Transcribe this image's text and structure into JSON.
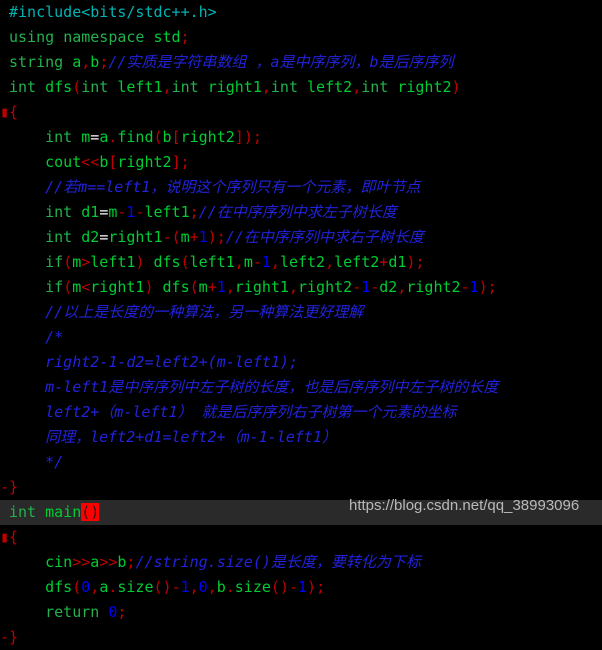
{
  "editor": {
    "background_color": "#000000",
    "highlight_line_color": "#2a2a2a",
    "selection_color": "#ff0000",
    "colors": {
      "keyword": "#22b14c",
      "identifier": "#00cc33",
      "preprocessor": "#00b4b4",
      "punctuation": "#c00000",
      "operator": "#ffffff",
      "number": "#0000ff",
      "comment": "#2222dd",
      "brace": "#c00000",
      "watermark": "#b9b9b9"
    },
    "language": "C++",
    "total_lines": 21
  },
  "code": {
    "l01": {
      "pre": "#include<bits/stdc++.h>"
    },
    "l02": {
      "kw1": "using",
      "sp1": " ",
      "kw2": "namespace",
      "sp2": " ",
      "id1": "std",
      "punc1": ";"
    },
    "l03": {
      "kw1": "string",
      "sp1": " ",
      "id1": "a",
      "punc1": ",",
      "id2": "b",
      "punc2": ";",
      "cmt": "//实质是字符串数组 ，a是中序序列，b是后序序列"
    },
    "l04": {
      "kw1": "int",
      "sp1": " ",
      "id1": "dfs",
      "punc1": "(",
      "kw2": "int",
      "sp2": " ",
      "id2": "left1",
      "punc2": ",",
      "kw3": "int",
      "sp3": " ",
      "id3": "right1",
      "punc3": ",",
      "kw4": "int",
      "sp4": " ",
      "id4": "left2",
      "punc4": ",",
      "kw5": "int",
      "sp5": " ",
      "id5": "right2",
      "punc5": ")"
    },
    "l05": {
      "marker": "▮",
      "brace": "{"
    },
    "l06": {
      "indent": "    ",
      "kw1": "int",
      "sp1": " ",
      "id1": "m",
      "op1": "=",
      "id2": "a",
      "dot": ".",
      "id3": "find",
      "punc1": "(",
      "id4": "b",
      "punc2": "[",
      "id5": "right2",
      "punc3": "]",
      "punc4": ")",
      "punc5": ";"
    },
    "l07": {
      "indent": "    ",
      "id1": "cout",
      "op1": "<<",
      "id2": "b",
      "punc1": "[",
      "id3": "right2",
      "punc2": "]",
      "punc3": ";"
    },
    "l08": {
      "indent": "    ",
      "cmt": "//若m==left1，说明这个序列只有一个元素，即叶节点"
    },
    "l09": {
      "indent": "    ",
      "kw1": "int",
      "sp1": " ",
      "id1": "d1",
      "op1": "=",
      "id2": "m",
      "op2": "-",
      "num1": "1",
      "op3": "-",
      "id3": "left1",
      "punc1": ";",
      "cmt": "//在中序序列中求左子树长度"
    },
    "l10": {
      "indent": "    ",
      "kw1": "int",
      "sp1": " ",
      "id1": "d2",
      "op1": "=",
      "id2": "right1",
      "op2": "-",
      "punc1": "(",
      "id3": "m",
      "op3": "+",
      "num1": "1",
      "punc2": ")",
      "punc3": ";",
      "cmt": "//在中序序列中求右子树长度"
    },
    "l11": {
      "indent": "    ",
      "kw1": "if",
      "punc1": "(",
      "id1": "m",
      "op1": ">",
      "id2": "left1",
      "punc2": ")",
      "sp1": " ",
      "id3": "dfs",
      "punc3": "(",
      "id4": "left1",
      "punc4": ",",
      "id5": "m",
      "op2": "-",
      "num1": "1",
      "punc5": ",",
      "id6": "left2",
      "punc6": ",",
      "id7": "left2",
      "op3": "+",
      "id8": "d1",
      "punc7": ")",
      "punc8": ";"
    },
    "l12": {
      "indent": "    ",
      "kw1": "if",
      "punc1": "(",
      "id1": "m",
      "op1": "<",
      "id2": "right1",
      "punc2": ")",
      "sp1": " ",
      "id3": "dfs",
      "punc3": "(",
      "id4": "m",
      "op2": "+",
      "num1": "1",
      "punc4": ",",
      "id5": "right1",
      "punc5": ",",
      "id6": "right2",
      "op3": "-",
      "num2": "1",
      "op4": "-",
      "id7": "d2",
      "punc6": ",",
      "id8": "right2",
      "op5": "-",
      "num3": "1",
      "punc7": ")",
      "punc8": ";"
    },
    "l13": {
      "indent": "    ",
      "cmt": "//以上是长度的一种算法，另一种算法更好理解"
    },
    "l14": {
      "indent": "    ",
      "cmt": "/*"
    },
    "l15": {
      "indent": "    ",
      "cmt": "right2-1-d2=left2+(m-left1);"
    },
    "l16": {
      "indent": "    ",
      "cmt": "m-left1是中序序列中左子树的长度，也是后序序列中左子树的长度"
    },
    "l17": {
      "indent": "    ",
      "cmt": "left2+（m-left1） 就是后序序列右子树第一个元素的坐标"
    },
    "l18": {
      "indent": "    ",
      "cmt": "同理，left2+d1=left2+（m-1-left1）"
    },
    "l19": {
      "indent": "    ",
      "cmt": "*/"
    },
    "l20": {
      "marker": "-",
      "brace": "}"
    },
    "l21": {
      "kw1": "int",
      "sp1": " ",
      "id1": "main",
      "sel": "()"
    },
    "l22": {
      "marker": "▮",
      "brace": "{"
    },
    "l23": {
      "indent": "    ",
      "id1": "cin",
      "op1": ">>",
      "id2": "a",
      "op2": ">>",
      "id3": "b",
      "punc1": ";",
      "cmt": "//string.size()是长度，要转化为下标"
    },
    "l24": {
      "indent": "    ",
      "id1": "dfs",
      "punc1": "(",
      "num1": "0",
      "punc2": ",",
      "id2": "a",
      "dot1": ".",
      "id3": "size",
      "punc3": "()",
      "op1": "-",
      "num2": "1",
      "punc4": ",",
      "num3": "0",
      "punc5": ",",
      "id4": "b",
      "dot2": ".",
      "id5": "size",
      "punc6": "()",
      "op2": "-",
      "num4": "1",
      "punc7": ")",
      "punc8": ";"
    },
    "l25": {
      "indent": "    ",
      "kw1": "return",
      "sp1": " ",
      "num1": "0",
      "punc1": ";"
    },
    "l26": {
      "marker": "-",
      "brace": "}"
    }
  },
  "watermark": {
    "text": "https://blog.csdn.net/qq_38993096"
  }
}
